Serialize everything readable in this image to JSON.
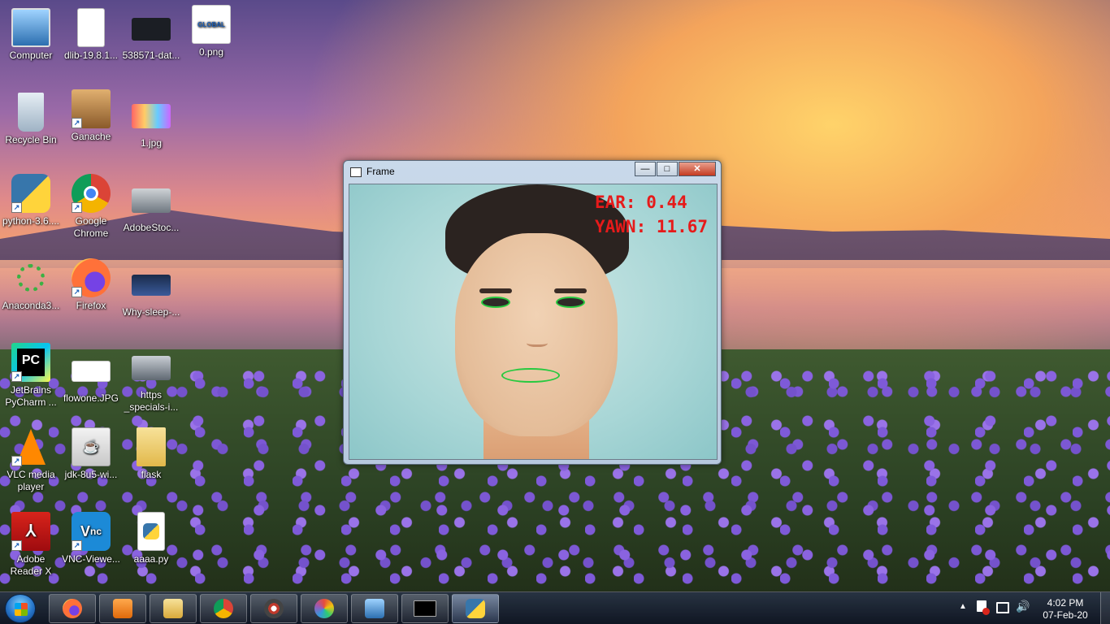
{
  "desktop": {
    "icons": [
      {
        "label": "Computer",
        "icon": "computer-icon"
      },
      {
        "label": "dlib-19.8.1...",
        "icon": "file-icon"
      },
      {
        "label": "538571-dat...",
        "icon": "image-icon"
      },
      {
        "label": "0.png",
        "icon": "image-icon"
      },
      {
        "label": "Recycle Bin",
        "icon": "recycle-bin-icon"
      },
      {
        "label": "Ganache",
        "icon": "ganache-icon"
      },
      {
        "label": "1.jpg",
        "icon": "image-icon"
      },
      {
        "label": "python-3.6....",
        "icon": "python-installer-icon"
      },
      {
        "label": "Google Chrome",
        "icon": "chrome-icon"
      },
      {
        "label": "AdobeStoc...",
        "icon": "image-icon"
      },
      {
        "label": "Anaconda3...",
        "icon": "anaconda-icon"
      },
      {
        "label": "Firefox",
        "icon": "firefox-icon"
      },
      {
        "label": "Why-sleep-...",
        "icon": "image-icon"
      },
      {
        "label": "JetBrains PyCharm ...",
        "icon": "pycharm-icon"
      },
      {
        "label": "flowone.JPG",
        "icon": "image-icon"
      },
      {
        "label": "https _specials-i...",
        "icon": "image-icon"
      },
      {
        "label": "VLC media player",
        "icon": "vlc-icon"
      },
      {
        "label": "jdk-8u5-wi...",
        "icon": "java-installer-icon"
      },
      {
        "label": "flask",
        "icon": "folder-icon"
      },
      {
        "label": "Adobe Reader X",
        "icon": "adobe-reader-icon"
      },
      {
        "label": "VNC-Viewe...",
        "icon": "vnc-icon"
      },
      {
        "label": "aaaa.py",
        "icon": "python-file-icon"
      }
    ]
  },
  "window": {
    "title": "Frame",
    "overlay": {
      "ear": "EAR: 0.44",
      "yawn": "YAWN: 11.67"
    },
    "buttons": {
      "minimize": "—",
      "maximize": "□",
      "close": "✕"
    }
  },
  "taskbar": {
    "apps": [
      "firefox-icon",
      "media-player-icon",
      "file-explorer-icon",
      "chrome-icon",
      "network-app-icon",
      "paint-icon",
      "control-panel-icon",
      "cmd-icon",
      "python-icon"
    ],
    "clock": {
      "time": "4:02 PM",
      "date": "07-Feb-20"
    }
  },
  "colors": {
    "overlay_text": "#e61a1a",
    "landmark_outline": "#27c93f"
  }
}
